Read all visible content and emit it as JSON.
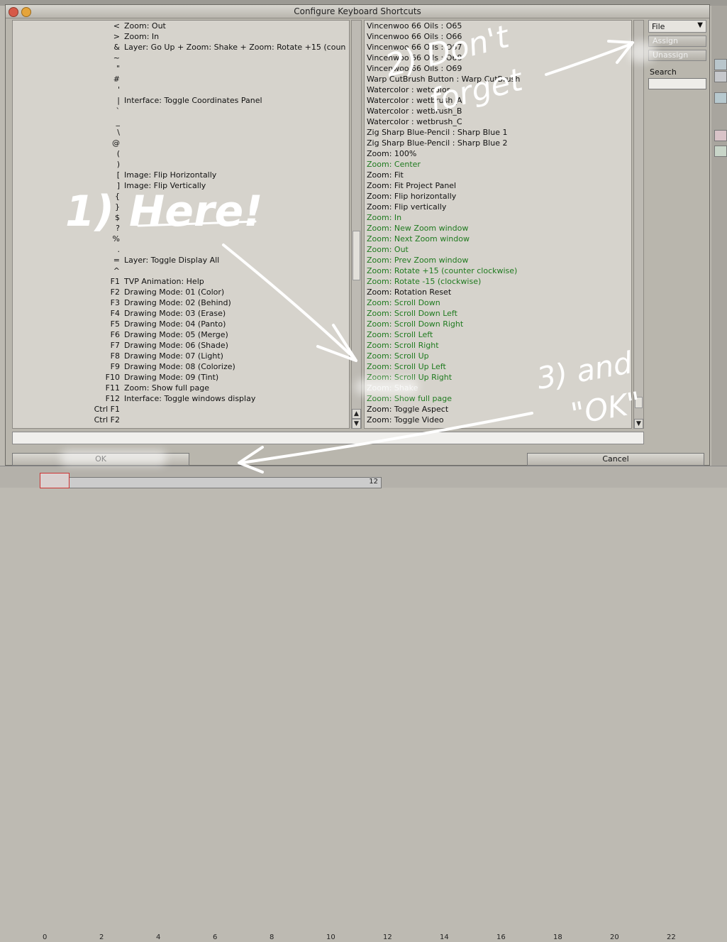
{
  "window": {
    "title": "Configure Keyboard Shortcuts"
  },
  "left_list": [
    {
      "key": "<",
      "action": "Zoom: Out"
    },
    {
      "key": ">",
      "action": "Zoom: In"
    },
    {
      "key": "&",
      "action": "Layer: Go Up + Zoom: Shake + Zoom: Rotate +15 (coun"
    },
    {
      "key": "~",
      "action": ""
    },
    {
      "key": "\"",
      "action": ""
    },
    {
      "key": "#",
      "action": ""
    },
    {
      "key": "'",
      "action": ""
    },
    {
      "key": "|",
      "action": "Interface: Toggle Coordinates Panel"
    },
    {
      "key": "`",
      "action": ""
    },
    {
      "key": "_",
      "action": ""
    },
    {
      "key": "\\",
      "action": ""
    },
    {
      "key": "@",
      "action": ""
    },
    {
      "key": "(",
      "action": ""
    },
    {
      "key": ")",
      "action": ""
    },
    {
      "key": "[",
      "action": "Image: Flip Horizontally"
    },
    {
      "key": "]",
      "action": "Image: Flip Vertically"
    },
    {
      "key": "{",
      "action": ""
    },
    {
      "key": "}",
      "action": ""
    },
    {
      "key": "$",
      "action": ""
    },
    {
      "key": "?",
      "action": ""
    },
    {
      "key": "%",
      "action": ""
    },
    {
      "key": ".",
      "action": ""
    },
    {
      "key": "=",
      "action": "Layer: Toggle Display All"
    },
    {
      "key": "^",
      "action": ""
    },
    {
      "key": "F1",
      "action": "TVP Animation: Help"
    },
    {
      "key": "F2",
      "action": "Drawing Mode: 01 (Color)"
    },
    {
      "key": "F3",
      "action": "Drawing Mode: 02 (Behind)"
    },
    {
      "key": "F4",
      "action": "Drawing Mode: 03 (Erase)"
    },
    {
      "key": "F5",
      "action": "Drawing Mode: 04 (Panto)"
    },
    {
      "key": "F6",
      "action": "Drawing Mode: 05 (Merge)"
    },
    {
      "key": "F7",
      "action": "Drawing Mode: 06 (Shade)"
    },
    {
      "key": "F8",
      "action": "Drawing Mode: 07 (Light)"
    },
    {
      "key": "F9",
      "action": "Drawing Mode: 08 (Colorize)"
    },
    {
      "key": "F10",
      "action": "Drawing Mode: 09 (Tint)"
    },
    {
      "key": "F11",
      "action": "Zoom: Show full page"
    },
    {
      "key": "F12",
      "action": "Interface: Toggle windows display"
    },
    {
      "key": "Ctrl F1",
      "action": ""
    },
    {
      "key": "Ctrl F2",
      "action": ""
    }
  ],
  "right_list": [
    {
      "text": "Vincenwoo 66 Oils : O65",
      "state": "normal"
    },
    {
      "text": "Vincenwoo 66 Oils : O66",
      "state": "normal"
    },
    {
      "text": "Vincenwoo 66 Oils : O67",
      "state": "normal"
    },
    {
      "text": "Vincenwoo 66 Oils : O68",
      "state": "normal"
    },
    {
      "text": "Vincenwoo 66 Oils : O69",
      "state": "normal"
    },
    {
      "text": "Warp CutBrush Button : Warp CutBrush",
      "state": "normal"
    },
    {
      "text": "Watercolor : wetcolor",
      "state": "normal"
    },
    {
      "text": "Watercolor : wetbrush_A",
      "state": "normal"
    },
    {
      "text": "Watercolor : wetbrush_B",
      "state": "normal"
    },
    {
      "text": "Watercolor : wetbrush_C",
      "state": "normal"
    },
    {
      "text": "Zig Sharp Blue-Pencil : Sharp Blue 1",
      "state": "normal"
    },
    {
      "text": "Zig Sharp Blue-Pencil : Sharp Blue 2",
      "state": "normal"
    },
    {
      "text": "Zoom: 100%",
      "state": "normal"
    },
    {
      "text": "Zoom: Center",
      "state": "green"
    },
    {
      "text": "Zoom: Fit",
      "state": "normal"
    },
    {
      "text": "Zoom: Fit Project Panel",
      "state": "normal"
    },
    {
      "text": "Zoom: Flip horizontally",
      "state": "normal"
    },
    {
      "text": "Zoom: Flip vertically",
      "state": "normal"
    },
    {
      "text": "Zoom: In",
      "state": "green"
    },
    {
      "text": "Zoom: New Zoom window",
      "state": "green"
    },
    {
      "text": "Zoom: Next Zoom window",
      "state": "green"
    },
    {
      "text": "Zoom: Out",
      "state": "green"
    },
    {
      "text": "Zoom: Prev Zoom window",
      "state": "green"
    },
    {
      "text": "Zoom: Rotate +15 (counter clockwise)",
      "state": "green"
    },
    {
      "text": "Zoom: Rotate -15 (clockwise)",
      "state": "green"
    },
    {
      "text": "Zoom: Rotation Reset",
      "state": "normal"
    },
    {
      "text": "Zoom: Scroll Down",
      "state": "green"
    },
    {
      "text": "Zoom: Scroll Down Left",
      "state": "green"
    },
    {
      "text": "Zoom: Scroll Down Right",
      "state": "green"
    },
    {
      "text": "Zoom: Scroll Left",
      "state": "green"
    },
    {
      "text": "Zoom: Scroll Right",
      "state": "green"
    },
    {
      "text": "Zoom: Scroll Up",
      "state": "green"
    },
    {
      "text": "Zoom: Scroll Up Left",
      "state": "green"
    },
    {
      "text": "Zoom: Scroll Up Right",
      "state": "green"
    },
    {
      "text": "Zoom: Shake",
      "state": "selected"
    },
    {
      "text": "Zoom: Show full page",
      "state": "green"
    },
    {
      "text": "Zoom: Toggle Aspect",
      "state": "normal"
    },
    {
      "text": "Zoom: Toggle Video",
      "state": "normal"
    }
  ],
  "sidebar": {
    "file_label": "File",
    "assign_label": "Assign",
    "unassign_label": "Unassign",
    "search_label": "Search",
    "search_value": ""
  },
  "buttons": {
    "ok_label": "OK",
    "cancel_label": "Cancel"
  },
  "ruler": {
    "labels": [
      "0",
      "2",
      "4",
      "6",
      "8",
      "10",
      "12",
      "14",
      "16",
      "18",
      "20",
      "22"
    ],
    "frame_label": "12"
  },
  "annotations": {
    "note1": "1) Here!",
    "note2_line1": "2) Don't",
    "note2_line2": "forget",
    "note3_line1": "3) and",
    "note3_line2": "\"OK\""
  },
  "colors": {
    "assigned_text": "#1f7a1f",
    "selected_text": "#f2f2f2",
    "annotation": "#ffffff"
  }
}
